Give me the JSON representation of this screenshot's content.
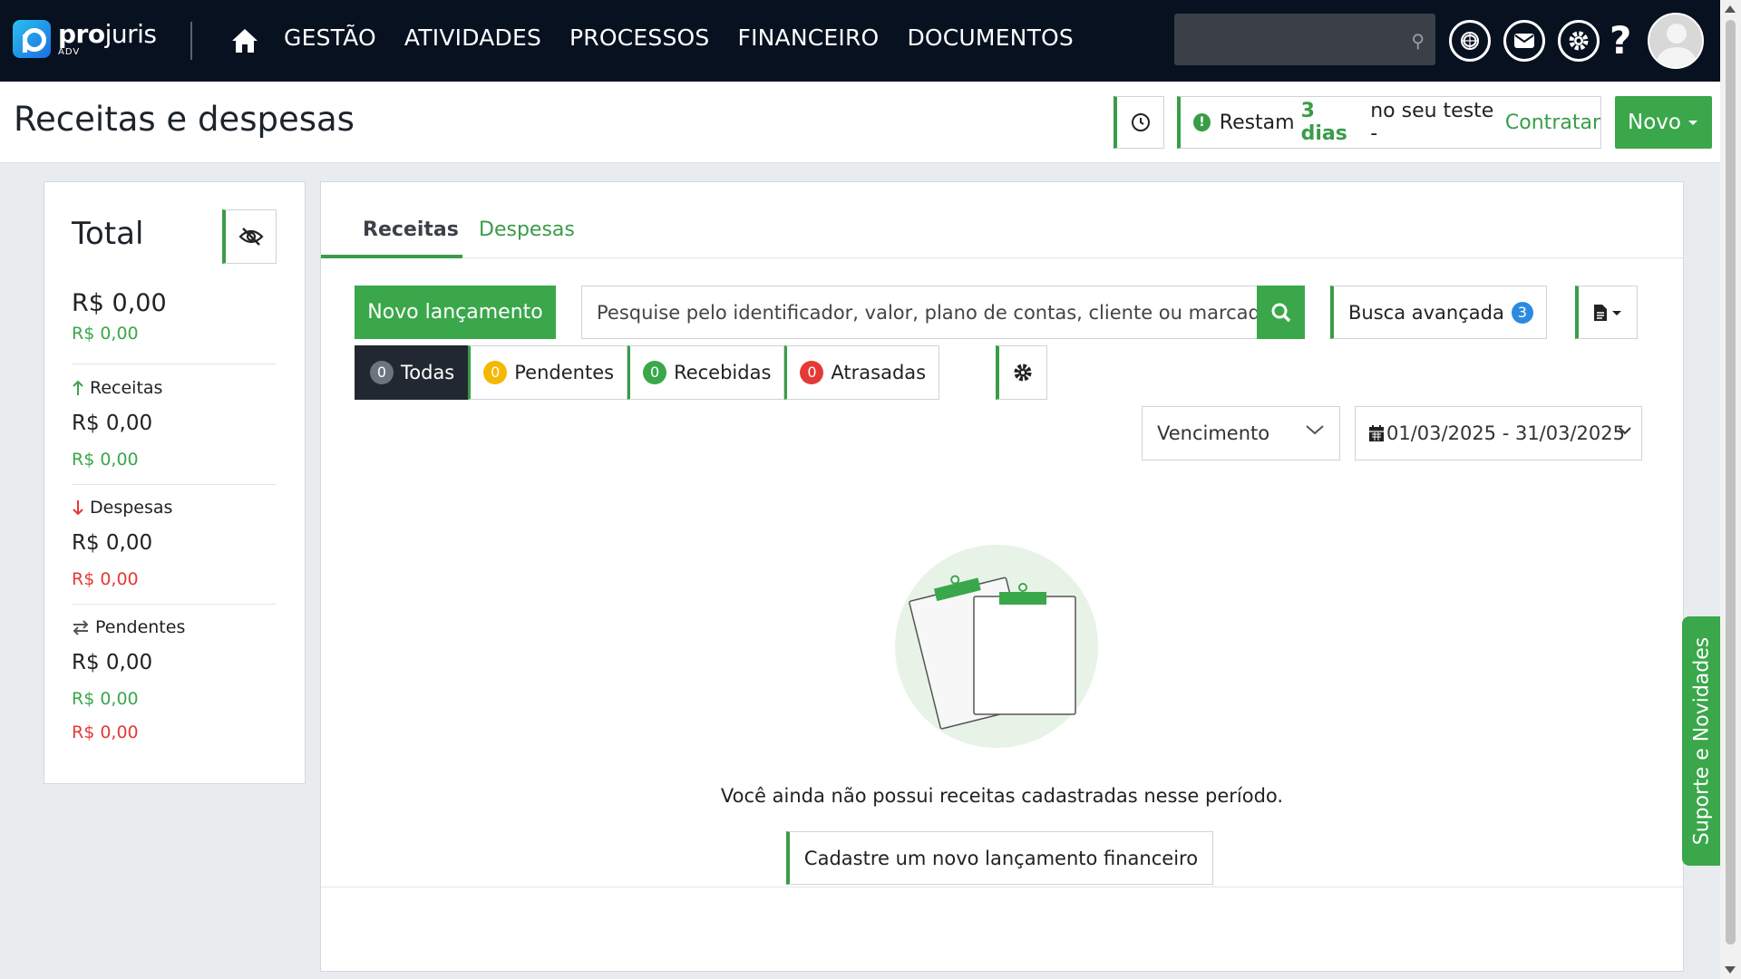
{
  "brand": {
    "name_bold": "pro",
    "name_rest": "juris",
    "sub": "ADV"
  },
  "nav": {
    "links": [
      "GESTÃO",
      "ATIVIDADES",
      "PROCESSOS",
      "FINANCEIRO",
      "DOCUMENTOS"
    ],
    "help": "?"
  },
  "header": {
    "title": "Receitas e despesas",
    "trial_prefix": "Restam",
    "trial_days": "3 dias",
    "trial_middle": "no seu teste -",
    "trial_link": "Contratar",
    "novo_label": "Novo"
  },
  "totals": {
    "title": "Total",
    "main_value": "R$ 0,00",
    "main_sub": "R$ 0,00",
    "receitas": {
      "label": "Receitas",
      "value": "R$ 0,00",
      "sub": "R$ 0,00"
    },
    "despesas": {
      "label": "Despesas",
      "value": "R$ 0,00",
      "sub": "R$ 0,00"
    },
    "pendentes": {
      "label": "Pendentes",
      "value": "R$ 0,00",
      "sub_green": "R$ 0,00",
      "sub_red": "R$ 0,00"
    }
  },
  "tabs": {
    "active": "Receitas",
    "inactive": "Despesas"
  },
  "toolbar": {
    "novo_lancamento": "Novo lançamento",
    "search_placeholder": "Pesquise pelo identificador, valor, plano de contas, cliente ou marcador",
    "busca_avancada": "Busca avançada",
    "busca_badge": "3"
  },
  "filters": [
    {
      "label": "Todas",
      "count": "0",
      "color": "#6c757d"
    },
    {
      "label": "Pendentes",
      "count": "0",
      "color": "#f5b800"
    },
    {
      "label": "Recebidas",
      "count": "0",
      "color": "#3aa74a"
    },
    {
      "label": "Atrasadas",
      "count": "0",
      "color": "#e53935"
    }
  ],
  "date_filter": {
    "type": "Vencimento",
    "range": "01/03/2025 - 31/03/2025"
  },
  "empty": {
    "message": "Você ainda não possui receitas cadastradas nesse período.",
    "cta": "Cadastre um novo lançamento financeiro"
  },
  "support_tab": "Suporte e Novidades",
  "colors": {
    "accent": "#3aa74a",
    "navbar": "#071120",
    "danger": "#e53935",
    "info": "#2d8ae0"
  }
}
